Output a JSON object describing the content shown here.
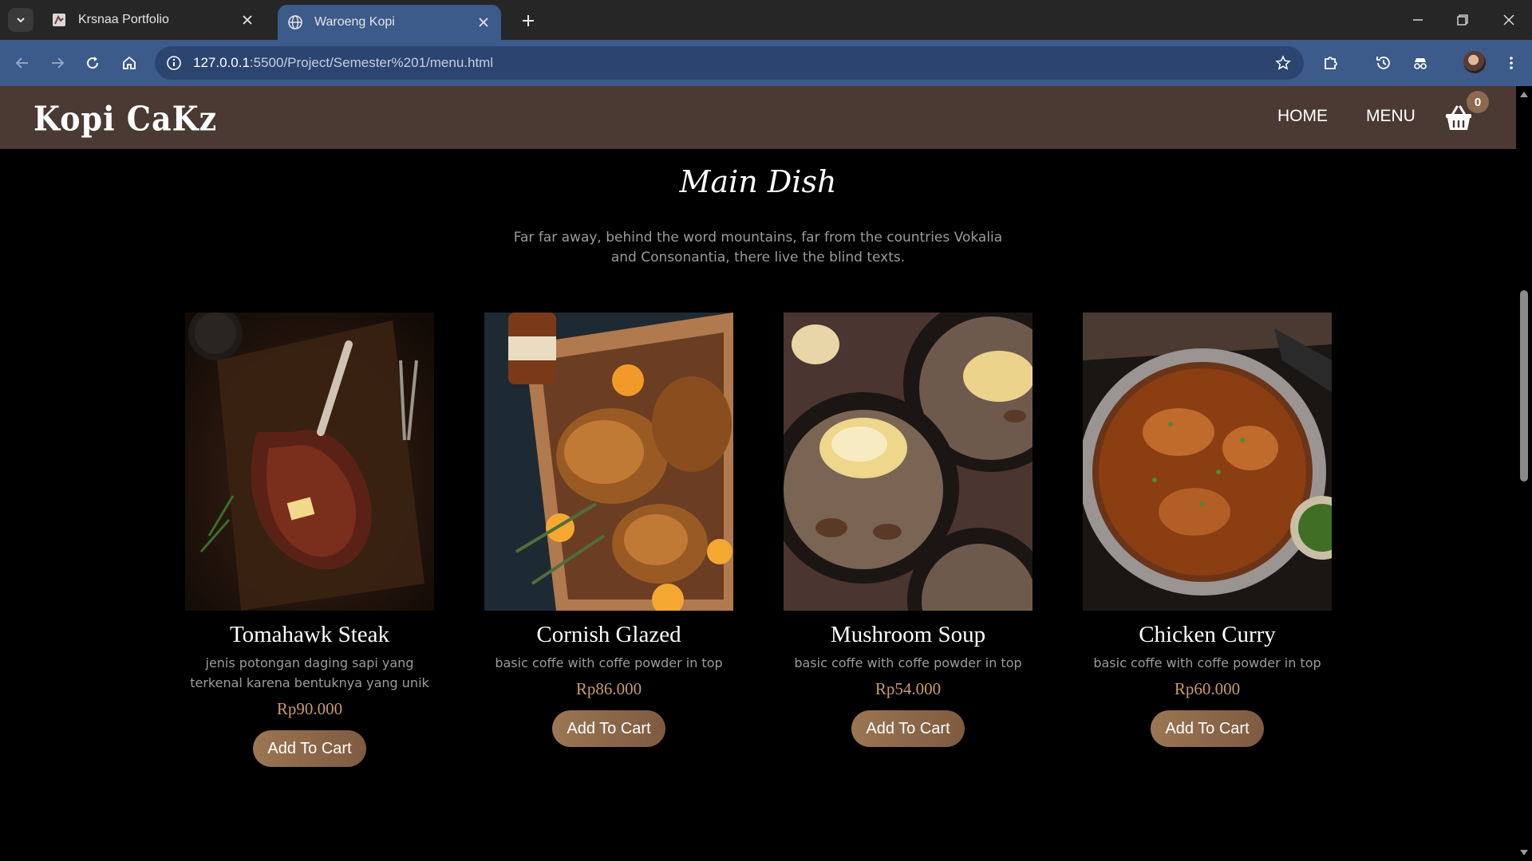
{
  "browser": {
    "tabs": [
      {
        "title": "Krsnaa Portfolio",
        "active": false
      },
      {
        "title": "Waroeng Kopi",
        "active": true
      }
    ],
    "url_host": "127.0.0.1",
    "url_rest": ":5500/Project/Semester%201/menu.html"
  },
  "site": {
    "logo": "Kopi CaKz",
    "nav": {
      "home": "HOME",
      "menu": "MENU"
    },
    "cart_count": "0"
  },
  "section": {
    "title": "Main Dish",
    "description": "Far far away, behind the word mountains, far from the countries Vokalia and Consonantia, there live the blind texts."
  },
  "menu_items": [
    {
      "name": "Tomahawk Steak",
      "description": "jenis potongan daging sapi yang terkenal karena bentuknya yang unik",
      "price": "Rp90.000",
      "button": "Add To Cart",
      "image": "steak-photo"
    },
    {
      "name": "Cornish Glazed",
      "description": "basic coffe with coffe powder in top",
      "price": "Rp86.000",
      "button": "Add To Cart",
      "image": "roast-chicken-photo"
    },
    {
      "name": "Mushroom Soup",
      "description": "basic coffe with coffe powder in top",
      "price": "Rp54.000",
      "button": "Add To Cart",
      "image": "mushroom-soup-photo"
    },
    {
      "name": "Chicken Curry",
      "description": "basic coffe with coffe powder in top",
      "price": "Rp60.000",
      "button": "Add To Cart",
      "image": "chicken-curry-photo"
    }
  ],
  "colors": {
    "nav_bg": "#4a3a33",
    "accent": "#c89b6d",
    "button": "#8d6a4f",
    "browser_accent": "#3c5a8a"
  }
}
